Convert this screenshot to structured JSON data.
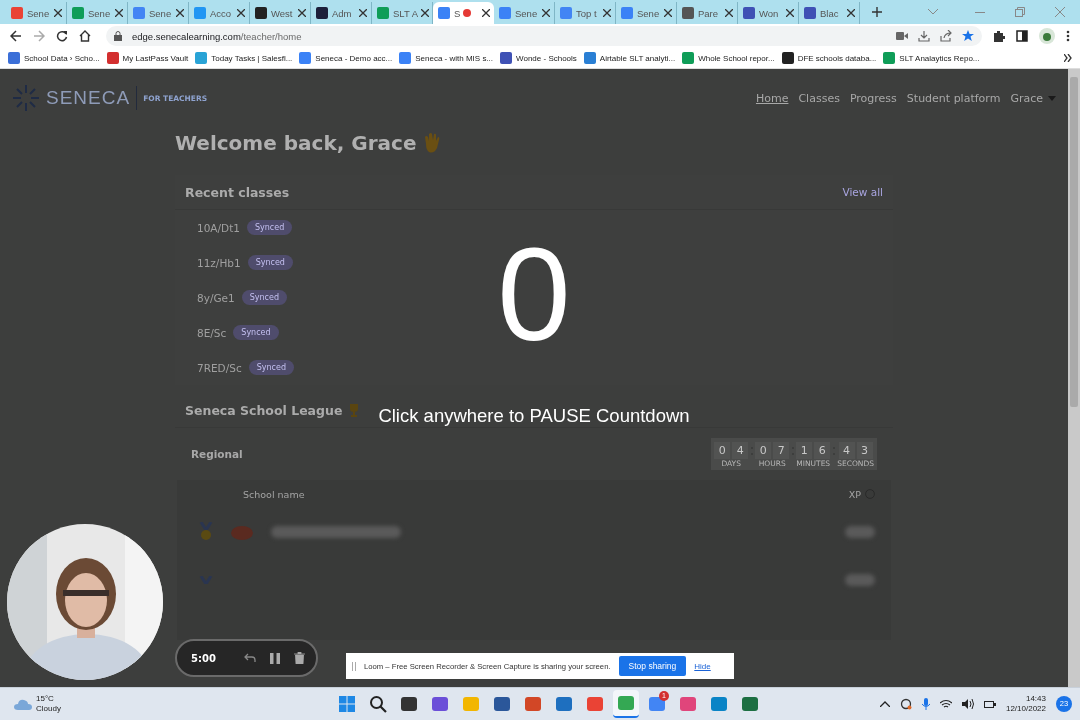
{
  "browser": {
    "tabs": [
      {
        "title": "Sene",
        "selected": false,
        "recording": false
      },
      {
        "title": "Sene",
        "selected": false,
        "recording": false
      },
      {
        "title": "Sene",
        "selected": false,
        "recording": false
      },
      {
        "title": "Acco",
        "selected": false,
        "recording": false
      },
      {
        "title": "West",
        "selected": false,
        "recording": false
      },
      {
        "title": "Adm",
        "selected": false,
        "recording": false
      },
      {
        "title": "SLT A",
        "selected": false,
        "recording": false
      },
      {
        "title": "S",
        "selected": true,
        "recording": true
      },
      {
        "title": "Sene",
        "selected": false,
        "recording": false
      },
      {
        "title": "Top t",
        "selected": false,
        "recording": false
      },
      {
        "title": "Sene",
        "selected": false,
        "recording": false
      },
      {
        "title": "Pare",
        "selected": false,
        "recording": false
      },
      {
        "title": "Won",
        "selected": false,
        "recording": false
      },
      {
        "title": "Blac",
        "selected": false,
        "recording": false
      }
    ],
    "url_host": "edge.senecalearning.com",
    "url_path": "/teacher/home",
    "bookmarks": [
      "School Data › Scho...",
      "My LastPass Vault",
      "Today Tasks | Salesfl...",
      "Seneca - Demo acc...",
      "Seneca - with MIS s...",
      "Wonde - Schools",
      "Airtable SLT analyti...",
      "Whole School repor...",
      "DFE schools databa...",
      "SLT Analaytics Repo..."
    ]
  },
  "site": {
    "logo": "SENECA",
    "logo_tag": "FOR TEACHERS",
    "nav": [
      {
        "label": "Home",
        "selected": true
      },
      {
        "label": "Classes",
        "selected": false
      },
      {
        "label": "Progress",
        "selected": false
      },
      {
        "label": "Student platform",
        "selected": false
      }
    ],
    "user_menu": "Grace"
  },
  "welcome": "Welcome back, Grace",
  "recent_classes": {
    "title": "Recent classes",
    "link": "View all",
    "classes": [
      {
        "name": "10A/Dt1",
        "badge": "Synced"
      },
      {
        "name": "11z/Hb1",
        "badge": "Synced"
      },
      {
        "name": "8y/Ge1",
        "badge": "Synced"
      },
      {
        "name": "8E/Sc",
        "badge": "Synced"
      },
      {
        "name": "7RED/Sc",
        "badge": "Synced"
      }
    ]
  },
  "league": {
    "title": "Seneca School League",
    "region": "Regional",
    "timer": [
      {
        "digits": [
          "0",
          "4"
        ],
        "unit": "DAYS"
      },
      {
        "digits": [
          "0",
          "7"
        ],
        "unit": "HOURS"
      },
      {
        "digits": [
          "1",
          "6"
        ],
        "unit": "MINUTES"
      },
      {
        "digits": [
          "4",
          "3"
        ],
        "unit": "SECONDS"
      }
    ],
    "columns": [
      "School name",
      "XP"
    ]
  },
  "countdown": {
    "number": "0",
    "hint": "Click anywhere to PAUSE Countdown"
  },
  "recorder": {
    "timer": "5:00",
    "share_message": "Loom – Free Screen Recorder & Screen Capture is sharing your screen.",
    "stop_button": "Stop sharing",
    "hide_link": "Hide"
  },
  "taskbar": {
    "temperature": "15°C",
    "condition": "Cloudy",
    "apps": [
      {
        "selected": false
      },
      {
        "selected": false
      },
      {
        "selected": false
      },
      {
        "selected": false
      },
      {
        "selected": false
      },
      {
        "selected": false
      },
      {
        "selected": false
      },
      {
        "selected": false
      },
      {
        "selected": false
      },
      {
        "selected": true
      },
      {
        "selected": false,
        "badge": "1"
      },
      {
        "selected": false
      },
      {
        "selected": false
      },
      {
        "selected": false
      }
    ],
    "time": "14:43",
    "date": "12/10/2022",
    "notifications": "23"
  }
}
